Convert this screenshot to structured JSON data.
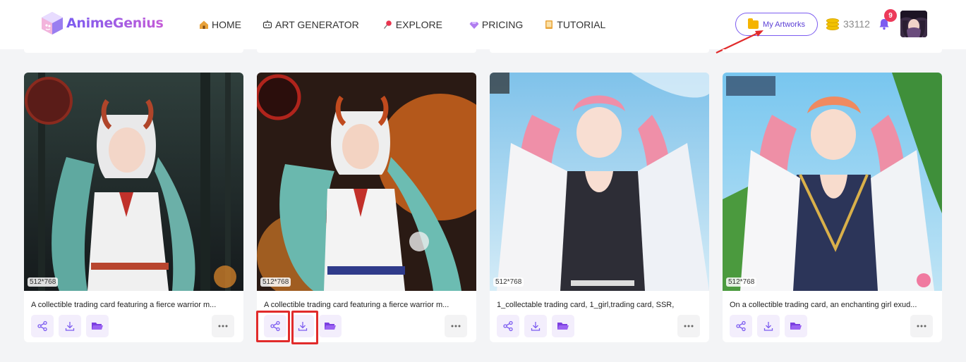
{
  "brand": {
    "name": "AnimeGenius"
  },
  "nav": {
    "items": [
      {
        "label": "HOME",
        "icon": "home-icon"
      },
      {
        "label": "ART GENERATOR",
        "icon": "robot-icon"
      },
      {
        "label": "EXPLORE",
        "icon": "pin-icon"
      },
      {
        "label": "PRICING",
        "icon": "diamond-icon"
      },
      {
        "label": "TUTORIAL",
        "icon": "book-icon"
      }
    ]
  },
  "header": {
    "my_artworks_label": "My Artworks",
    "coins": "33112",
    "notification_count": "9"
  },
  "gallery": {
    "cards": [
      {
        "dimensions": "512*768",
        "caption": "A collectible trading card featuring a fierce warrior m..."
      },
      {
        "dimensions": "512*768",
        "caption": "A collectible trading card featuring a fierce warrior m..."
      },
      {
        "dimensions": "512*768",
        "caption": "1_collectable trading card, 1_girl,trading card, SSR,"
      },
      {
        "dimensions": "512*768",
        "caption": "On a collectible trading card, an enchanting girl exud..."
      }
    ]
  },
  "colors": {
    "accent": "#7c5cf0",
    "highlight": "#e12b2b",
    "badge": "#ec3a5a"
  }
}
